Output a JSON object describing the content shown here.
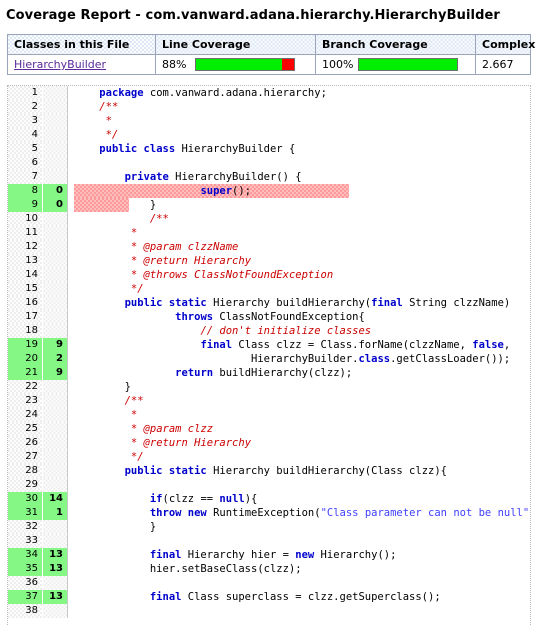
{
  "page": {
    "title": "Coverage Report - com.vanward.adana.hierarchy.HierarchyBuilder"
  },
  "summary": {
    "headers": {
      "classes": "Classes in this File",
      "line_coverage": "Line Coverage",
      "branch_coverage": "Branch Coverage",
      "complexity": "Complexity"
    },
    "row": {
      "class_name": "HierarchyBuilder",
      "line_pct_label": "88%",
      "line_pct_value": 88,
      "branch_pct_label": "100%",
      "branch_pct_value": 100,
      "complexity": "2.667"
    },
    "colors": {
      "covered": "#00ee00",
      "uncovered": "#ff0000",
      "gutter_covered": "#85f785",
      "line_uncovered_highlight": "#ff9a9a",
      "link": "#5a2a9b",
      "header_bg": "#dfe8f6"
    }
  },
  "source": {
    "lines": [
      {
        "n": "1",
        "hits": "",
        "state": "none",
        "code": "    <b>package</b> com.vanward.adana.hierarchy;"
      },
      {
        "n": "2",
        "hits": "",
        "state": "none",
        "code": "    <i>/**</i>"
      },
      {
        "n": "3",
        "hits": "",
        "state": "none",
        "code": "     <i>*</i>"
      },
      {
        "n": "4",
        "hits": "",
        "state": "none",
        "code": "     <i>*/</i>"
      },
      {
        "n": "5",
        "hits": "",
        "state": "none",
        "code": "    <b>public class</b> HierarchyBuilder {"
      },
      {
        "n": "6",
        "hits": "",
        "state": "none",
        "code": ""
      },
      {
        "n": "7",
        "hits": "",
        "state": "none",
        "code": "        <b>private</b> HierarchyBuilder() {"
      },
      {
        "n": "8",
        "hits": "0",
        "state": "uncovered",
        "code": "                    <b>super</b>();",
        "hl_width": 275
      },
      {
        "n": "9",
        "hits": "0",
        "state": "uncovered",
        "code": "            }",
        "hl_width": 55
      },
      {
        "n": "10",
        "hits": "",
        "state": "none",
        "code": "            <i>/**</i>"
      },
      {
        "n": "11",
        "hits": "",
        "state": "none",
        "code": "         <i>*</i>"
      },
      {
        "n": "12",
        "hits": "",
        "state": "none",
        "code": "         <i>* @param clzzName</i>"
      },
      {
        "n": "13",
        "hits": "",
        "state": "none",
        "code": "         <i>* @return Hierarchy</i>"
      },
      {
        "n": "14",
        "hits": "",
        "state": "none",
        "code": "         <i>* @throws ClassNotFoundException</i>"
      },
      {
        "n": "15",
        "hits": "",
        "state": "none",
        "code": "         <i>*/</i>"
      },
      {
        "n": "16",
        "hits": "",
        "state": "none",
        "code": "        <b>public static</b> Hierarchy buildHierarchy(<b>final</b> String clzzName)"
      },
      {
        "n": "17",
        "hits": "",
        "state": "none",
        "code": "                <b>throws</b> ClassNotFoundException{"
      },
      {
        "n": "18",
        "hits": "",
        "state": "none",
        "code": "                    <i>// don't initialize classes</i>"
      },
      {
        "n": "19",
        "hits": "9",
        "state": "covered",
        "code": "                    <b>final</b> Class clzz = Class.forName(clzzName, <b>false</b>,"
      },
      {
        "n": "20",
        "hits": "2",
        "state": "covered",
        "code": "                            HierarchyBuilder.<b>class</b>.getClassLoader());"
      },
      {
        "n": "21",
        "hits": "9",
        "state": "covered",
        "code": "                <b>return</b> buildHierarchy(clzz);"
      },
      {
        "n": "22",
        "hits": "",
        "state": "none",
        "code": "        }"
      },
      {
        "n": "23",
        "hits": "",
        "state": "none",
        "code": "        <i>/**</i>"
      },
      {
        "n": "24",
        "hits": "",
        "state": "none",
        "code": "         <i>*</i>"
      },
      {
        "n": "25",
        "hits": "",
        "state": "none",
        "code": "         <i>* @param clzz</i>"
      },
      {
        "n": "26",
        "hits": "",
        "state": "none",
        "code": "         <i>* @return Hierarchy</i>"
      },
      {
        "n": "27",
        "hits": "",
        "state": "none",
        "code": "         <i>*/</i>"
      },
      {
        "n": "28",
        "hits": "",
        "state": "none",
        "code": "        <b>public static</b> Hierarchy buildHierarchy(Class clzz){"
      },
      {
        "n": "29",
        "hits": "",
        "state": "none",
        "code": ""
      },
      {
        "n": "30",
        "hits": "14",
        "state": "covered",
        "code": "            <b>if</b>(clzz == <b>null</b>){"
      },
      {
        "n": "31",
        "hits": "1",
        "state": "covered",
        "code": "            <b>throw new</b> RuntimeException(<s>\"Class parameter can not be null\"</s>"
      },
      {
        "n": "32",
        "hits": "",
        "state": "none",
        "code": "            }"
      },
      {
        "n": "33",
        "hits": "",
        "state": "none",
        "code": ""
      },
      {
        "n": "34",
        "hits": "13",
        "state": "covered",
        "code": "            <b>final</b> Hierarchy hier = <b>new</b> Hierarchy();"
      },
      {
        "n": "35",
        "hits": "13",
        "state": "covered",
        "code": "            hier.setBaseClass(clzz);"
      },
      {
        "n": "36",
        "hits": "",
        "state": "none",
        "code": ""
      },
      {
        "n": "37",
        "hits": "13",
        "state": "covered",
        "code": "            <b>final</b> Class superclass = clzz.getSuperclass();"
      },
      {
        "n": "38",
        "hits": "",
        "state": "none",
        "code": ""
      }
    ]
  }
}
